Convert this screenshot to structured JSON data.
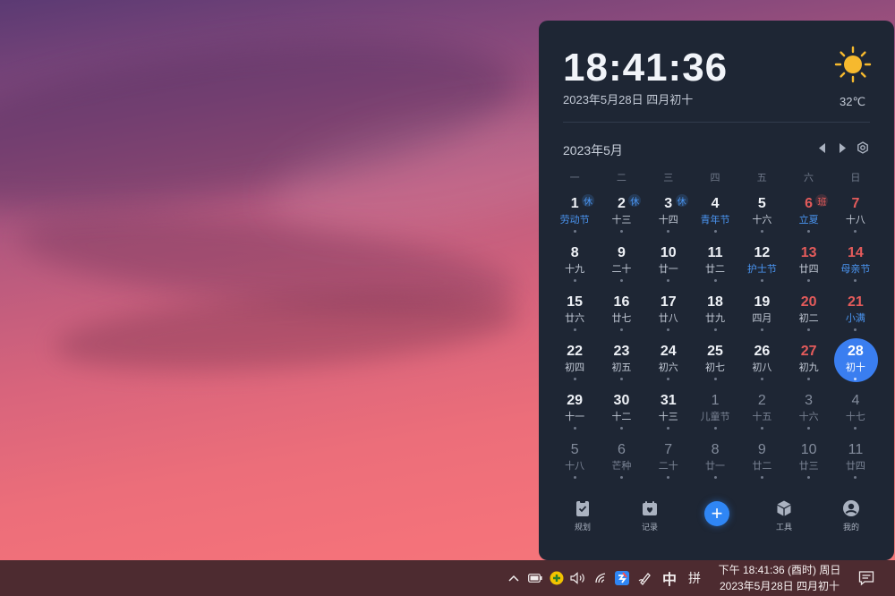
{
  "colors": {
    "accent": "#3a7ef0",
    "holiday_text": "#4a95f2",
    "weekend": "#e45b5b",
    "panel_bg": "#1e2634",
    "taskbar_bg": "#4d2b30"
  },
  "header": {
    "time": "18:41:36",
    "date": "2023年5月28日 四月初十",
    "weather_icon": "sun-icon",
    "temperature": "32℃"
  },
  "calendar": {
    "month_title": "2023年5月",
    "weekdays": [
      "一",
      "二",
      "三",
      "四",
      "五",
      "六",
      "日"
    ],
    "days": [
      {
        "num": "1",
        "lunar": "劳动节",
        "fest": true,
        "badge": "休",
        "badge_type": "rest",
        "weekend": false,
        "other": false
      },
      {
        "num": "2",
        "lunar": "十三",
        "fest": false,
        "badge": "休",
        "badge_type": "rest",
        "weekend": false,
        "other": false
      },
      {
        "num": "3",
        "lunar": "十四",
        "fest": false,
        "badge": "休",
        "badge_type": "rest",
        "weekend": false,
        "other": false
      },
      {
        "num": "4",
        "lunar": "青年节",
        "fest": true,
        "badge": "",
        "badge_type": "",
        "weekend": false,
        "other": false
      },
      {
        "num": "5",
        "lunar": "十六",
        "fest": false,
        "badge": "",
        "badge_type": "",
        "weekend": false,
        "other": false
      },
      {
        "num": "6",
        "lunar": "立夏",
        "fest": true,
        "badge": "班",
        "badge_type": "work",
        "weekend": true,
        "other": false
      },
      {
        "num": "7",
        "lunar": "十八",
        "fest": false,
        "badge": "",
        "badge_type": "",
        "weekend": true,
        "other": false
      },
      {
        "num": "8",
        "lunar": "十九",
        "fest": false,
        "badge": "",
        "badge_type": "",
        "weekend": false,
        "other": false
      },
      {
        "num": "9",
        "lunar": "二十",
        "fest": false,
        "badge": "",
        "badge_type": "",
        "weekend": false,
        "other": false
      },
      {
        "num": "10",
        "lunar": "廿一",
        "fest": false,
        "badge": "",
        "badge_type": "",
        "weekend": false,
        "other": false
      },
      {
        "num": "11",
        "lunar": "廿二",
        "fest": false,
        "badge": "",
        "badge_type": "",
        "weekend": false,
        "other": false
      },
      {
        "num": "12",
        "lunar": "护士节",
        "fest": true,
        "badge": "",
        "badge_type": "",
        "weekend": false,
        "other": false
      },
      {
        "num": "13",
        "lunar": "廿四",
        "fest": false,
        "badge": "",
        "badge_type": "",
        "weekend": true,
        "other": false
      },
      {
        "num": "14",
        "lunar": "母亲节",
        "fest": true,
        "badge": "",
        "badge_type": "",
        "weekend": true,
        "other": false
      },
      {
        "num": "15",
        "lunar": "廿六",
        "fest": false,
        "badge": "",
        "badge_type": "",
        "weekend": false,
        "other": false
      },
      {
        "num": "16",
        "lunar": "廿七",
        "fest": false,
        "badge": "",
        "badge_type": "",
        "weekend": false,
        "other": false
      },
      {
        "num": "17",
        "lunar": "廿八",
        "fest": false,
        "badge": "",
        "badge_type": "",
        "weekend": false,
        "other": false
      },
      {
        "num": "18",
        "lunar": "廿九",
        "fest": false,
        "badge": "",
        "badge_type": "",
        "weekend": false,
        "other": false
      },
      {
        "num": "19",
        "lunar": "四月",
        "fest": false,
        "badge": "",
        "badge_type": "",
        "weekend": false,
        "other": false
      },
      {
        "num": "20",
        "lunar": "初二",
        "fest": false,
        "badge": "",
        "badge_type": "",
        "weekend": true,
        "other": false
      },
      {
        "num": "21",
        "lunar": "小满",
        "fest": true,
        "badge": "",
        "badge_type": "",
        "weekend": true,
        "other": false
      },
      {
        "num": "22",
        "lunar": "初四",
        "fest": false,
        "badge": "",
        "badge_type": "",
        "weekend": false,
        "other": false
      },
      {
        "num": "23",
        "lunar": "初五",
        "fest": false,
        "badge": "",
        "badge_type": "",
        "weekend": false,
        "other": false
      },
      {
        "num": "24",
        "lunar": "初六",
        "fest": false,
        "badge": "",
        "badge_type": "",
        "weekend": false,
        "other": false
      },
      {
        "num": "25",
        "lunar": "初七",
        "fest": false,
        "badge": "",
        "badge_type": "",
        "weekend": false,
        "other": false
      },
      {
        "num": "26",
        "lunar": "初八",
        "fest": false,
        "badge": "",
        "badge_type": "",
        "weekend": false,
        "other": false
      },
      {
        "num": "27",
        "lunar": "初九",
        "fest": false,
        "badge": "",
        "badge_type": "",
        "weekend": true,
        "other": false
      },
      {
        "num": "28",
        "lunar": "初十",
        "fest": false,
        "badge": "",
        "badge_type": "",
        "weekend": true,
        "other": false,
        "today": true
      },
      {
        "num": "29",
        "lunar": "十一",
        "fest": false,
        "badge": "",
        "badge_type": "",
        "weekend": false,
        "other": false
      },
      {
        "num": "30",
        "lunar": "十二",
        "fest": false,
        "badge": "",
        "badge_type": "",
        "weekend": false,
        "other": false
      },
      {
        "num": "31",
        "lunar": "十三",
        "fest": false,
        "badge": "",
        "badge_type": "",
        "weekend": false,
        "other": false
      },
      {
        "num": "1",
        "lunar": "儿童节",
        "fest": false,
        "badge": "",
        "badge_type": "",
        "weekend": false,
        "other": true
      },
      {
        "num": "2",
        "lunar": "十五",
        "fest": false,
        "badge": "",
        "badge_type": "",
        "weekend": false,
        "other": true
      },
      {
        "num": "3",
        "lunar": "十六",
        "fest": false,
        "badge": "",
        "badge_type": "",
        "weekend": true,
        "other": true
      },
      {
        "num": "4",
        "lunar": "十七",
        "fest": false,
        "badge": "",
        "badge_type": "",
        "weekend": true,
        "other": true
      },
      {
        "num": "5",
        "lunar": "十八",
        "fest": false,
        "badge": "",
        "badge_type": "",
        "weekend": false,
        "other": true
      },
      {
        "num": "6",
        "lunar": "芒种",
        "fest": false,
        "badge": "",
        "badge_type": "",
        "weekend": false,
        "other": true
      },
      {
        "num": "7",
        "lunar": "二十",
        "fest": false,
        "badge": "",
        "badge_type": "",
        "weekend": false,
        "other": true
      },
      {
        "num": "8",
        "lunar": "廿一",
        "fest": false,
        "badge": "",
        "badge_type": "",
        "weekend": false,
        "other": true
      },
      {
        "num": "9",
        "lunar": "廿二",
        "fest": false,
        "badge": "",
        "badge_type": "",
        "weekend": false,
        "other": true
      },
      {
        "num": "10",
        "lunar": "廿三",
        "fest": false,
        "badge": "",
        "badge_type": "",
        "weekend": true,
        "other": true
      },
      {
        "num": "11",
        "lunar": "廿四",
        "fest": false,
        "badge": "",
        "badge_type": "",
        "weekend": true,
        "other": true
      }
    ]
  },
  "toolbar": {
    "plan_label": "规划",
    "record_label": "记录",
    "add_label": "+",
    "tools_label": "工具",
    "me_label": "我的"
  },
  "taskbar": {
    "ime_mode": "中",
    "ime_layout": "拼",
    "clock_line1": "下午 18:41:36 (酉时) 周日",
    "clock_line2": "2023年5月28日 四月初十"
  }
}
